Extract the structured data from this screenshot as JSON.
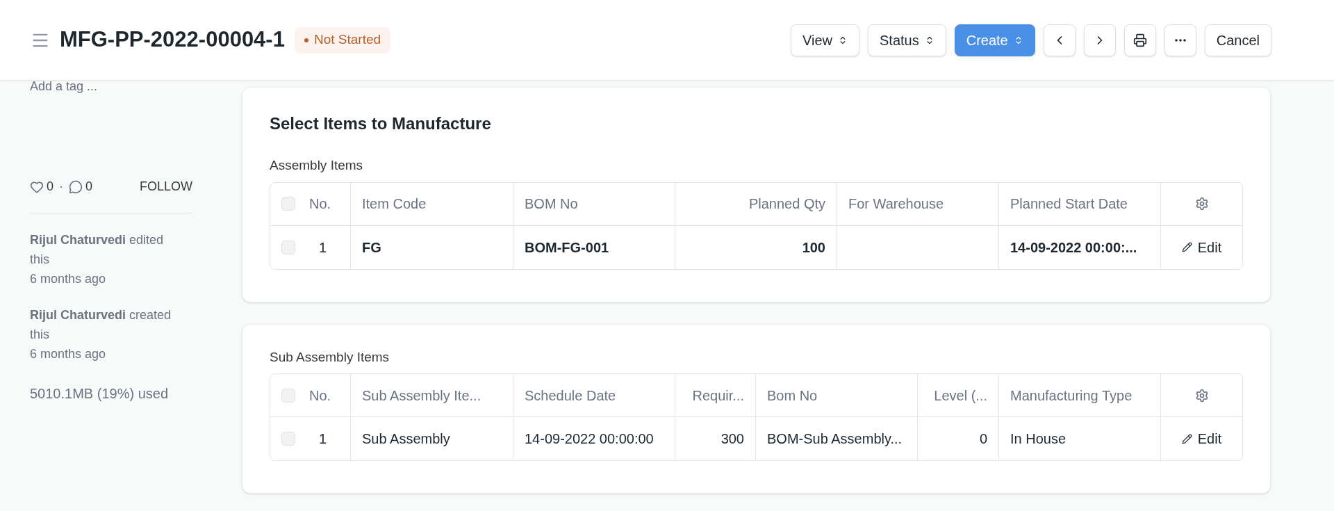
{
  "header": {
    "title": "MFG-PP-2022-00004-1",
    "status": {
      "label": "Not Started",
      "color": "#b45f2e"
    },
    "buttons": [
      {
        "kind": "dropdown",
        "label": "View",
        "primary": false
      },
      {
        "kind": "dropdown",
        "label": "Status",
        "primary": false
      },
      {
        "kind": "dropdown",
        "label": "Create",
        "primary": true
      },
      {
        "kind": "back",
        "primary": false
      },
      {
        "kind": "forward",
        "primary": false
      },
      {
        "kind": "print",
        "primary": false
      },
      {
        "kind": "more",
        "primary": false
      },
      {
        "kind": "plain",
        "label": "Cancel",
        "primary": false
      }
    ]
  },
  "sidebar": {
    "tag_placeholder": "Add a tag ...",
    "likes": "0",
    "separator": "·",
    "comments": "0",
    "follow": "FOLLOW",
    "activity": [
      {
        "text": "**Rijul Chaturvedi** edited this",
        "time": "6 months ago"
      },
      {
        "text": "**Rijul Chaturvedi** created this",
        "time": "6 months ago"
      }
    ],
    "storage": "5010.1MB (19%) used"
  },
  "sections": [
    {
      "title": "Select Items to Manufacture",
      "table": {
        "label": "Assembly Items",
        "bold_values": true,
        "select_all": {
          "checked": false
        },
        "columns": [
          {
            "label": "No.",
            "kind": "text"
          },
          {
            "label": "Item Code",
            "kind": "text"
          },
          {
            "label": "BOM No",
            "kind": "text"
          },
          {
            "label": "Planned Qty",
            "kind": "number"
          },
          {
            "label": "For Warehouse",
            "kind": "text"
          },
          {
            "label": "Planned Start Date",
            "kind": "text"
          }
        ],
        "rows": [
          {
            "checked": false,
            "cells": [
              "1",
              "FG",
              "BOM-FG-001",
              "100",
              "",
              "14-09-2022 00:00:..."
            ],
            "action": "Edit"
          }
        ]
      }
    },
    {
      "table": {
        "label": "Sub Assembly Items",
        "bold_values": false,
        "select_all": {
          "checked": false
        },
        "columns": [
          {
            "label": "No.",
            "kind": "text"
          },
          {
            "label": "Sub Assembly Ite...",
            "kind": "text"
          },
          {
            "label": "Schedule Date",
            "kind": "text"
          },
          {
            "label": "Requir...",
            "kind": "number"
          },
          {
            "label": "Bom No",
            "kind": "text"
          },
          {
            "label": "Level (...",
            "kind": "number"
          },
          {
            "label": "Manufacturing Type",
            "kind": "text"
          }
        ],
        "rows": [
          {
            "checked": false,
            "cells": [
              "1",
              "Sub Assembly",
              "14-09-2022 00:00:00",
              "300",
              "BOM-Sub Assembly...",
              "0",
              "In House"
            ],
            "action": "Edit"
          }
        ]
      }
    }
  ]
}
